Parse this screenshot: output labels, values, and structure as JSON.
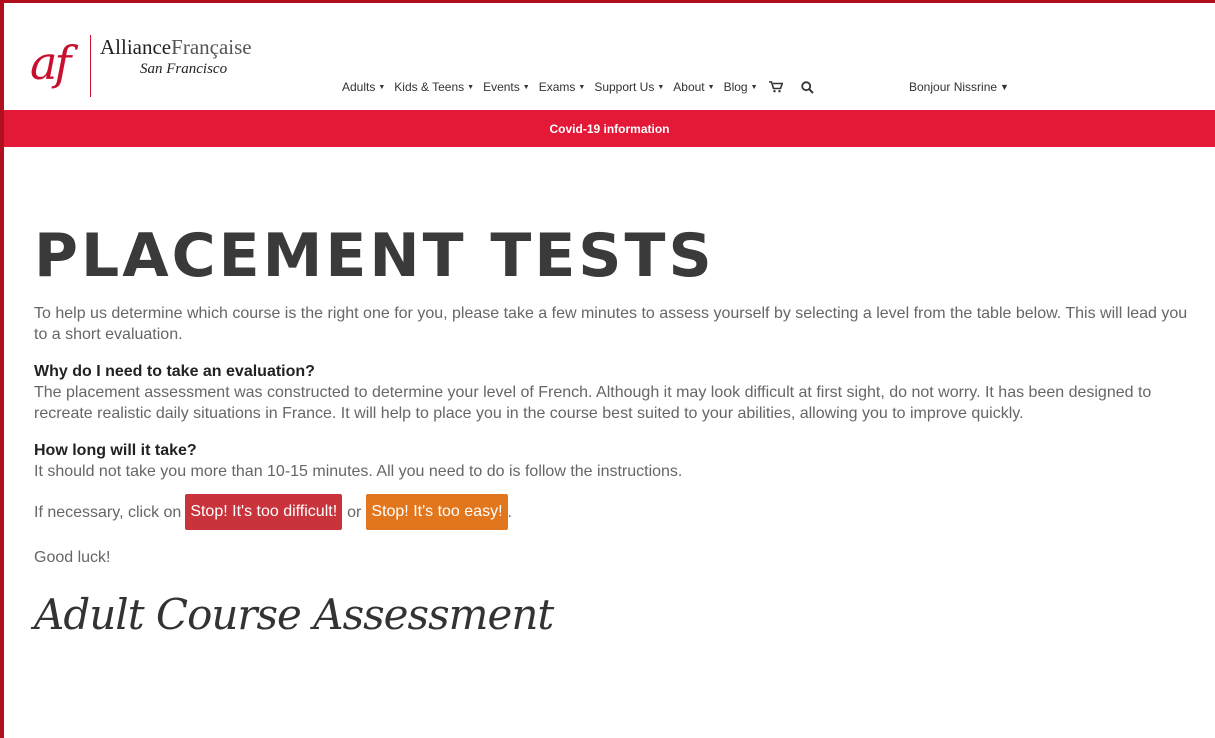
{
  "brand": {
    "logo_mark": "af",
    "name_bold": "Alliance",
    "name_light": "Française",
    "city": "San Francisco",
    "accent_color": "#c8102e"
  },
  "nav": {
    "items": [
      {
        "label": "Adults"
      },
      {
        "label": "Kids & Teens"
      },
      {
        "label": "Events"
      },
      {
        "label": "Exams"
      },
      {
        "label": "Support Us"
      },
      {
        "label": "About"
      },
      {
        "label": "Blog"
      }
    ],
    "cart_icon": "cart-icon",
    "search_icon": "search-icon",
    "user_greeting": "Bonjour Nissrine"
  },
  "banner": {
    "text": "Covid-19 information",
    "color": "#e31937"
  },
  "page": {
    "title": "PLACEMENT TESTS",
    "intro": "To help us determine which course is the right one for you, please take a few minutes to assess yourself by selecting a level from the table below. This will lead you to a short evaluation.",
    "q1_title": "Why do I need to take an evaluation?",
    "q1_text": "The placement assessment was constructed to determine your level of French. Although it may look difficult at first sight, do not worry. It has been designed to recreate realistic daily situations in France. It will help to place you in the course best suited to your abilities, allowing you to improve quickly.",
    "q2_title": "How long will it take?",
    "q2_text": "It should not take you more than 10-15 minutes. All you need to do is follow the instructions.",
    "click_prefix": "If necessary, click on",
    "btn_difficult": "Stop! It's too difficult!",
    "or": "or",
    "btn_easy": "Stop! It's too easy!",
    "click_suffix": ".",
    "good_luck": "Good luck!",
    "subtitle": "Adult Course Assessment",
    "difficult_color": "#c9333b",
    "easy_color": "#e2761c"
  }
}
